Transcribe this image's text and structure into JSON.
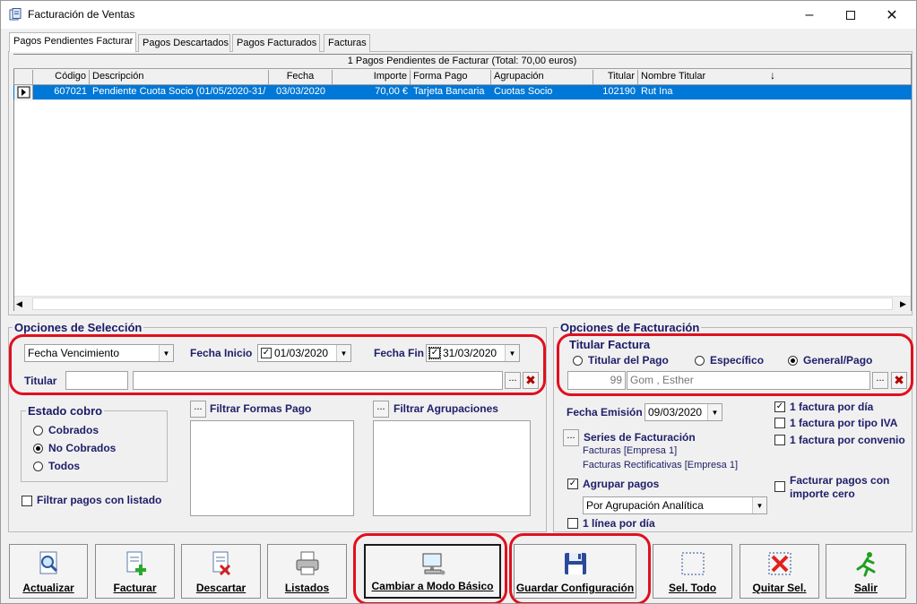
{
  "window": {
    "title": "Facturación de Ventas",
    "icon": "app-document-icon",
    "controls": [
      "minimize-icon",
      "maximize-icon",
      "close-icon"
    ]
  },
  "tabs": [
    "Pagos Pendientes Facturar",
    "Pagos Descartados",
    "Pagos Facturados",
    "Facturas"
  ],
  "grid": {
    "caption": "1 Pagos Pendientes de Facturar (Total: 70,00 euros)",
    "columns": [
      "Código",
      "Descripción",
      "Fecha",
      "Importe",
      "Forma Pago",
      "Agrupación",
      "Titular",
      "Nombre Titular"
    ],
    "rows": [
      [
        "607021",
        "Pendiente Cuota Socio (01/05/2020-31/",
        "03/03/2020",
        "70,00 €",
        "Tarjeta Bancaria",
        "Cuotas Socio",
        "102190",
        "Rut Ina"
      ]
    ]
  },
  "seleccion": {
    "title": "Opciones de Selección",
    "fecha_tipo": "Fecha Vencimiento",
    "fecha_inicio_label": "Fecha Inicio",
    "fecha_inicio": "01/03/2020",
    "fecha_fin_label": "Fecha Fin",
    "fecha_fin": "31/03/2020",
    "titular_label": "Titular",
    "titular_code": "",
    "titular_name": "",
    "estado_title": "Estado cobro",
    "estado_options": [
      "Cobrados",
      "No Cobrados",
      "Todos"
    ],
    "estado_selected": "No Cobrados",
    "filtrar_formas_pago": "Filtrar Formas Pago",
    "filtrar_agrupaciones": "Filtrar Agrupaciones",
    "filtrar_listado": "Filtrar pagos con listado"
  },
  "facturacion": {
    "title": "Opciones de Facturación",
    "titular_title": "Titular Factura",
    "titular_options": [
      "Titular del Pago",
      "Específico",
      "General/Pago"
    ],
    "titular_selected": "General/Pago",
    "titular_code": "99",
    "titular_name": "Gom , Esther",
    "fecha_emision_label": "Fecha Emisión",
    "fecha_emision": "09/03/2020",
    "series_label": "Series de Facturación",
    "series": [
      "Facturas [Empresa 1]",
      "Facturas Rectificativas [Empresa 1]"
    ],
    "agrupar_pagos": "Agrupar pagos",
    "agrupacion_tipo": "Por Agrupación Analítica",
    "linea_por_dia": "1 línea por día",
    "factura_por_dia": "1 factura por día",
    "factura_por_iva": "1 factura por tipo IVA",
    "factura_por_convenio": "1 factura por convenio",
    "facturar_importe_cero": "Facturar pagos con importe cero"
  },
  "toolbar": {
    "actualizar": "Actualizar",
    "facturar": "Facturar",
    "descartar": "Descartar",
    "listados": "Listados",
    "modo_basico": "Cambiar a Modo Básico",
    "guardar": "Guardar Configuración",
    "sel_todo": "Sel. Todo",
    "quitar_sel": "Quitar Sel.",
    "salir": "Salir"
  },
  "colors": {
    "selection": "#0078d7",
    "annotation_red": "#e0101e",
    "label_navy": "#20206a"
  }
}
